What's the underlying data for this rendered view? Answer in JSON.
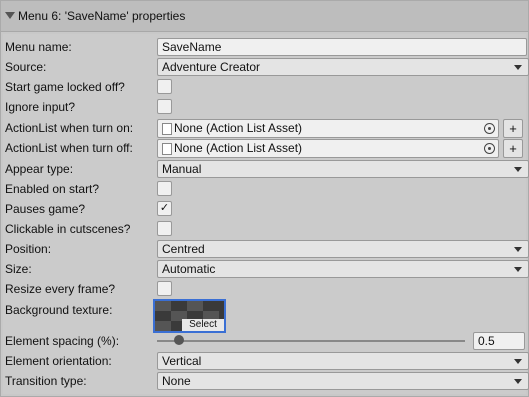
{
  "header": {
    "title": "Menu 6: 'SaveName' properties"
  },
  "fields": {
    "menu_name": {
      "label": "Menu name:",
      "value": "SaveName"
    },
    "source": {
      "label": "Source:",
      "value": "Adventure Creator"
    },
    "start_game_locked_off": {
      "label": "Start game locked off?",
      "checked": false
    },
    "ignore_input": {
      "label": "Ignore input?",
      "checked": false
    },
    "actionlist_on": {
      "label": "ActionList when turn on:",
      "value": "None (Action List Asset)",
      "button": "+"
    },
    "actionlist_off": {
      "label": "ActionList when turn off:",
      "value": "None (Action List Asset)",
      "button": "+"
    },
    "appear_type": {
      "label": "Appear type:",
      "value": "Manual"
    },
    "enabled_on_start": {
      "label": "Enabled on start?",
      "checked": false
    },
    "pauses_game": {
      "label": "Pauses game?",
      "checked": true,
      "mark": "✓"
    },
    "clickable_in_cutscenes": {
      "label": "Clickable in cutscenes?",
      "checked": false
    },
    "position": {
      "label": "Position:",
      "value": "Centred"
    },
    "size": {
      "label": "Size:",
      "value": "Automatic"
    },
    "resize_every_frame": {
      "label": "Resize every frame?",
      "checked": false
    },
    "background_texture": {
      "label": "Background texture:",
      "select_label": "Select"
    },
    "element_spacing": {
      "label": "Element spacing (%):",
      "value": "0.5"
    },
    "element_orientation": {
      "label": "Element orientation:",
      "value": "Vertical"
    },
    "transition_type": {
      "label": "Transition type:",
      "value": "None"
    }
  },
  "icons": {
    "collapse": "triangle-down-icon",
    "asset": "document-icon",
    "object_picker": "target-icon",
    "dropdown": "chevron-down-icon"
  },
  "colors": {
    "selection_border": "#3a6fd4",
    "panel_bg": "#cbcbcb"
  }
}
